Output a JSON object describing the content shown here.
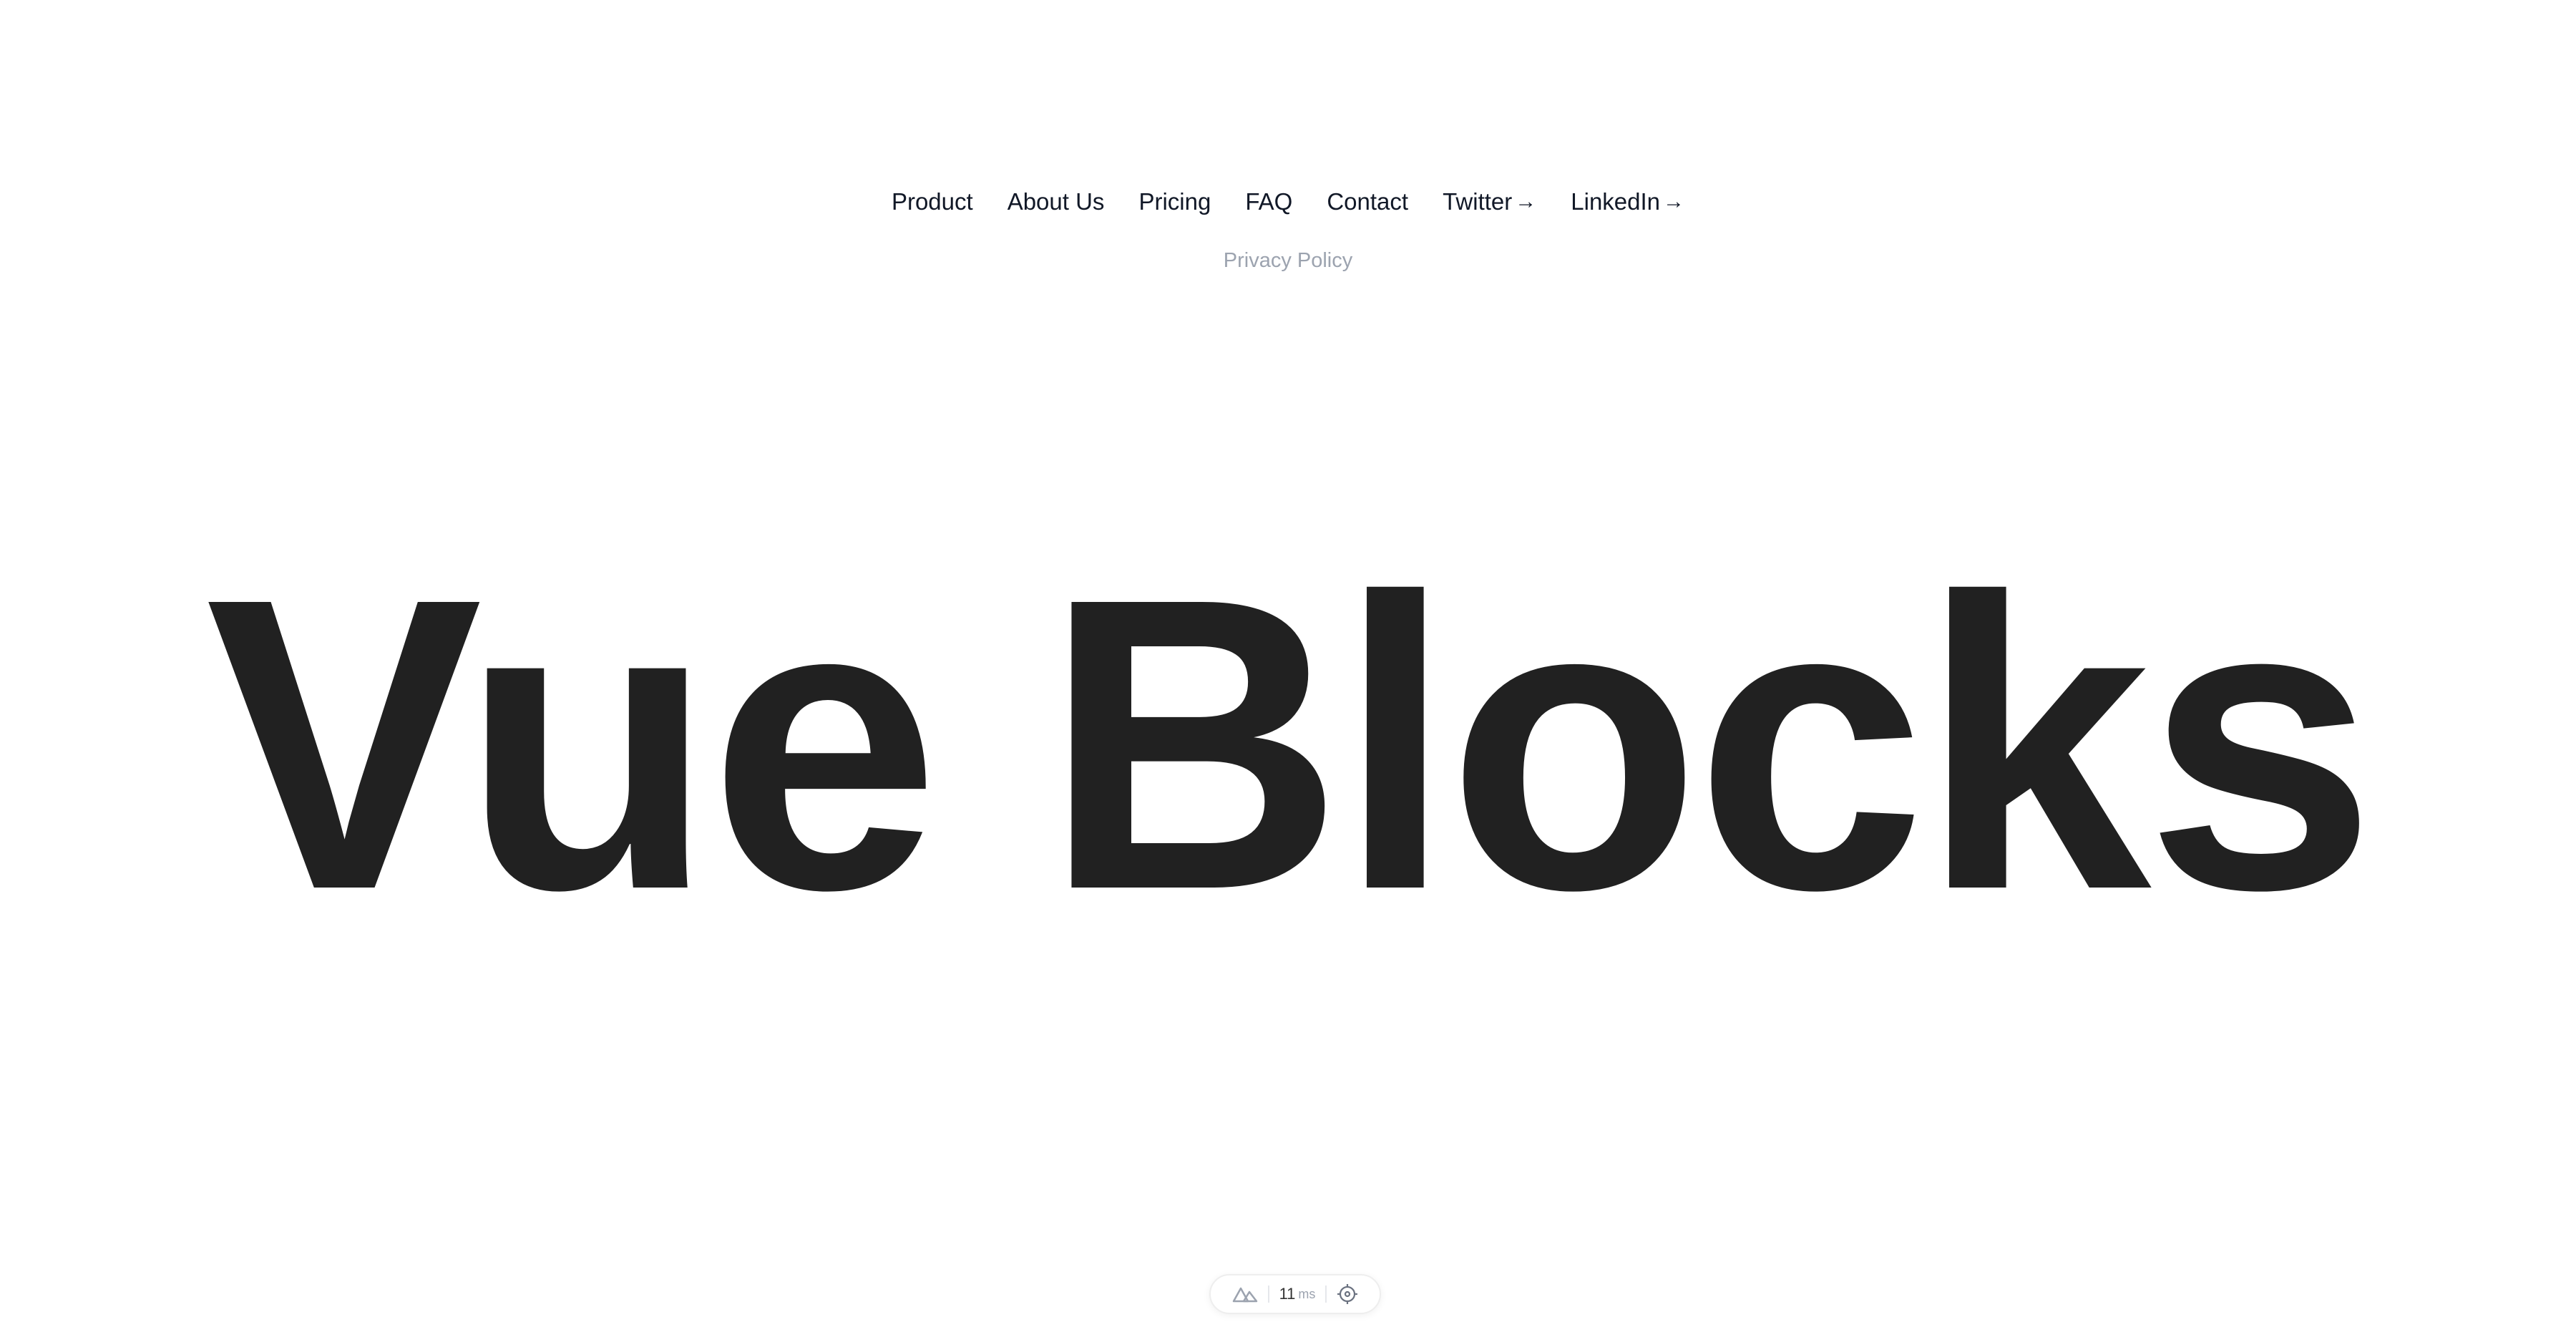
{
  "nav": {
    "links": [
      {
        "label": "Product"
      },
      {
        "label": "About Us"
      },
      {
        "label": "Pricing"
      },
      {
        "label": "FAQ"
      },
      {
        "label": "Contact"
      },
      {
        "label": "Twitter",
        "external": true
      },
      {
        "label": "LinkedIn",
        "external": true
      }
    ],
    "privacy": "Privacy Policy"
  },
  "hero": {
    "title": "Vue Blocks",
    "color": "#212121"
  },
  "devtools": {
    "render_time_value": "11",
    "render_time_unit": "ms",
    "left_icon": "nuxt-logo-icon",
    "right_icon": "crosshair-icon"
  }
}
